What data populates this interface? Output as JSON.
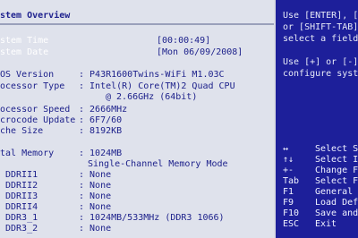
{
  "header": {
    "title": "stem Overview"
  },
  "left": {
    "system_time": {
      "label": "stem Time",
      "value": "[00:00:49]"
    },
    "system_date": {
      "label": "stem Date",
      "value": "[Mon 06/09/2008]"
    },
    "bios_version": {
      "label": "OS Version",
      "value": ": P43R1600Twins-WiFi M1.03C"
    },
    "processor_type": {
      "label": "ocessor Type",
      "value": ": Intel(R) Core(TM)2 Quad CPU",
      "value2": "@ 2.66GHz (64bit)"
    },
    "processor_speed": {
      "label": "ocessor Speed",
      "value": ": 2666MHz"
    },
    "microcode_update": {
      "label": "crocode Update",
      "value": ": 6F7/60"
    },
    "cache_size": {
      "label": "che Size",
      "value": ": 8192KB"
    },
    "total_memory": {
      "label": "tal Memory",
      "value": ": 1024MB",
      "mode": "Single-Channel Memory Mode"
    },
    "dimms": [
      {
        "label": "DDRII1",
        "value": ": None"
      },
      {
        "label": "DDRII2",
        "value": ": None"
      },
      {
        "label": "DDRII3",
        "value": ": None"
      },
      {
        "label": "DDRII4",
        "value": ": None"
      },
      {
        "label": "DDR3_1",
        "value": ": 1024MB/533MHz (DDR3 1066)"
      },
      {
        "label": "DDR3_2",
        "value": ": None"
      }
    ]
  },
  "right": {
    "help_lines": [
      "Use [ENTER], [",
      "or [SHIFT-TAB]",
      "select a field",
      "Use [+] or [-]",
      "configure syst"
    ],
    "keys": [
      {
        "key": "↔",
        "desc": "Select S"
      },
      {
        "key": "↑↓",
        "desc": "Select I"
      },
      {
        "key": "+-",
        "desc": "Change F"
      },
      {
        "key": "Tab",
        "desc": "Select F"
      },
      {
        "key": "F1",
        "desc": "General"
      },
      {
        "key": "F9",
        "desc": "Load Def"
      },
      {
        "key": "F10",
        "desc": "Save and"
      },
      {
        "key": "ESC",
        "desc": "Exit"
      }
    ]
  }
}
